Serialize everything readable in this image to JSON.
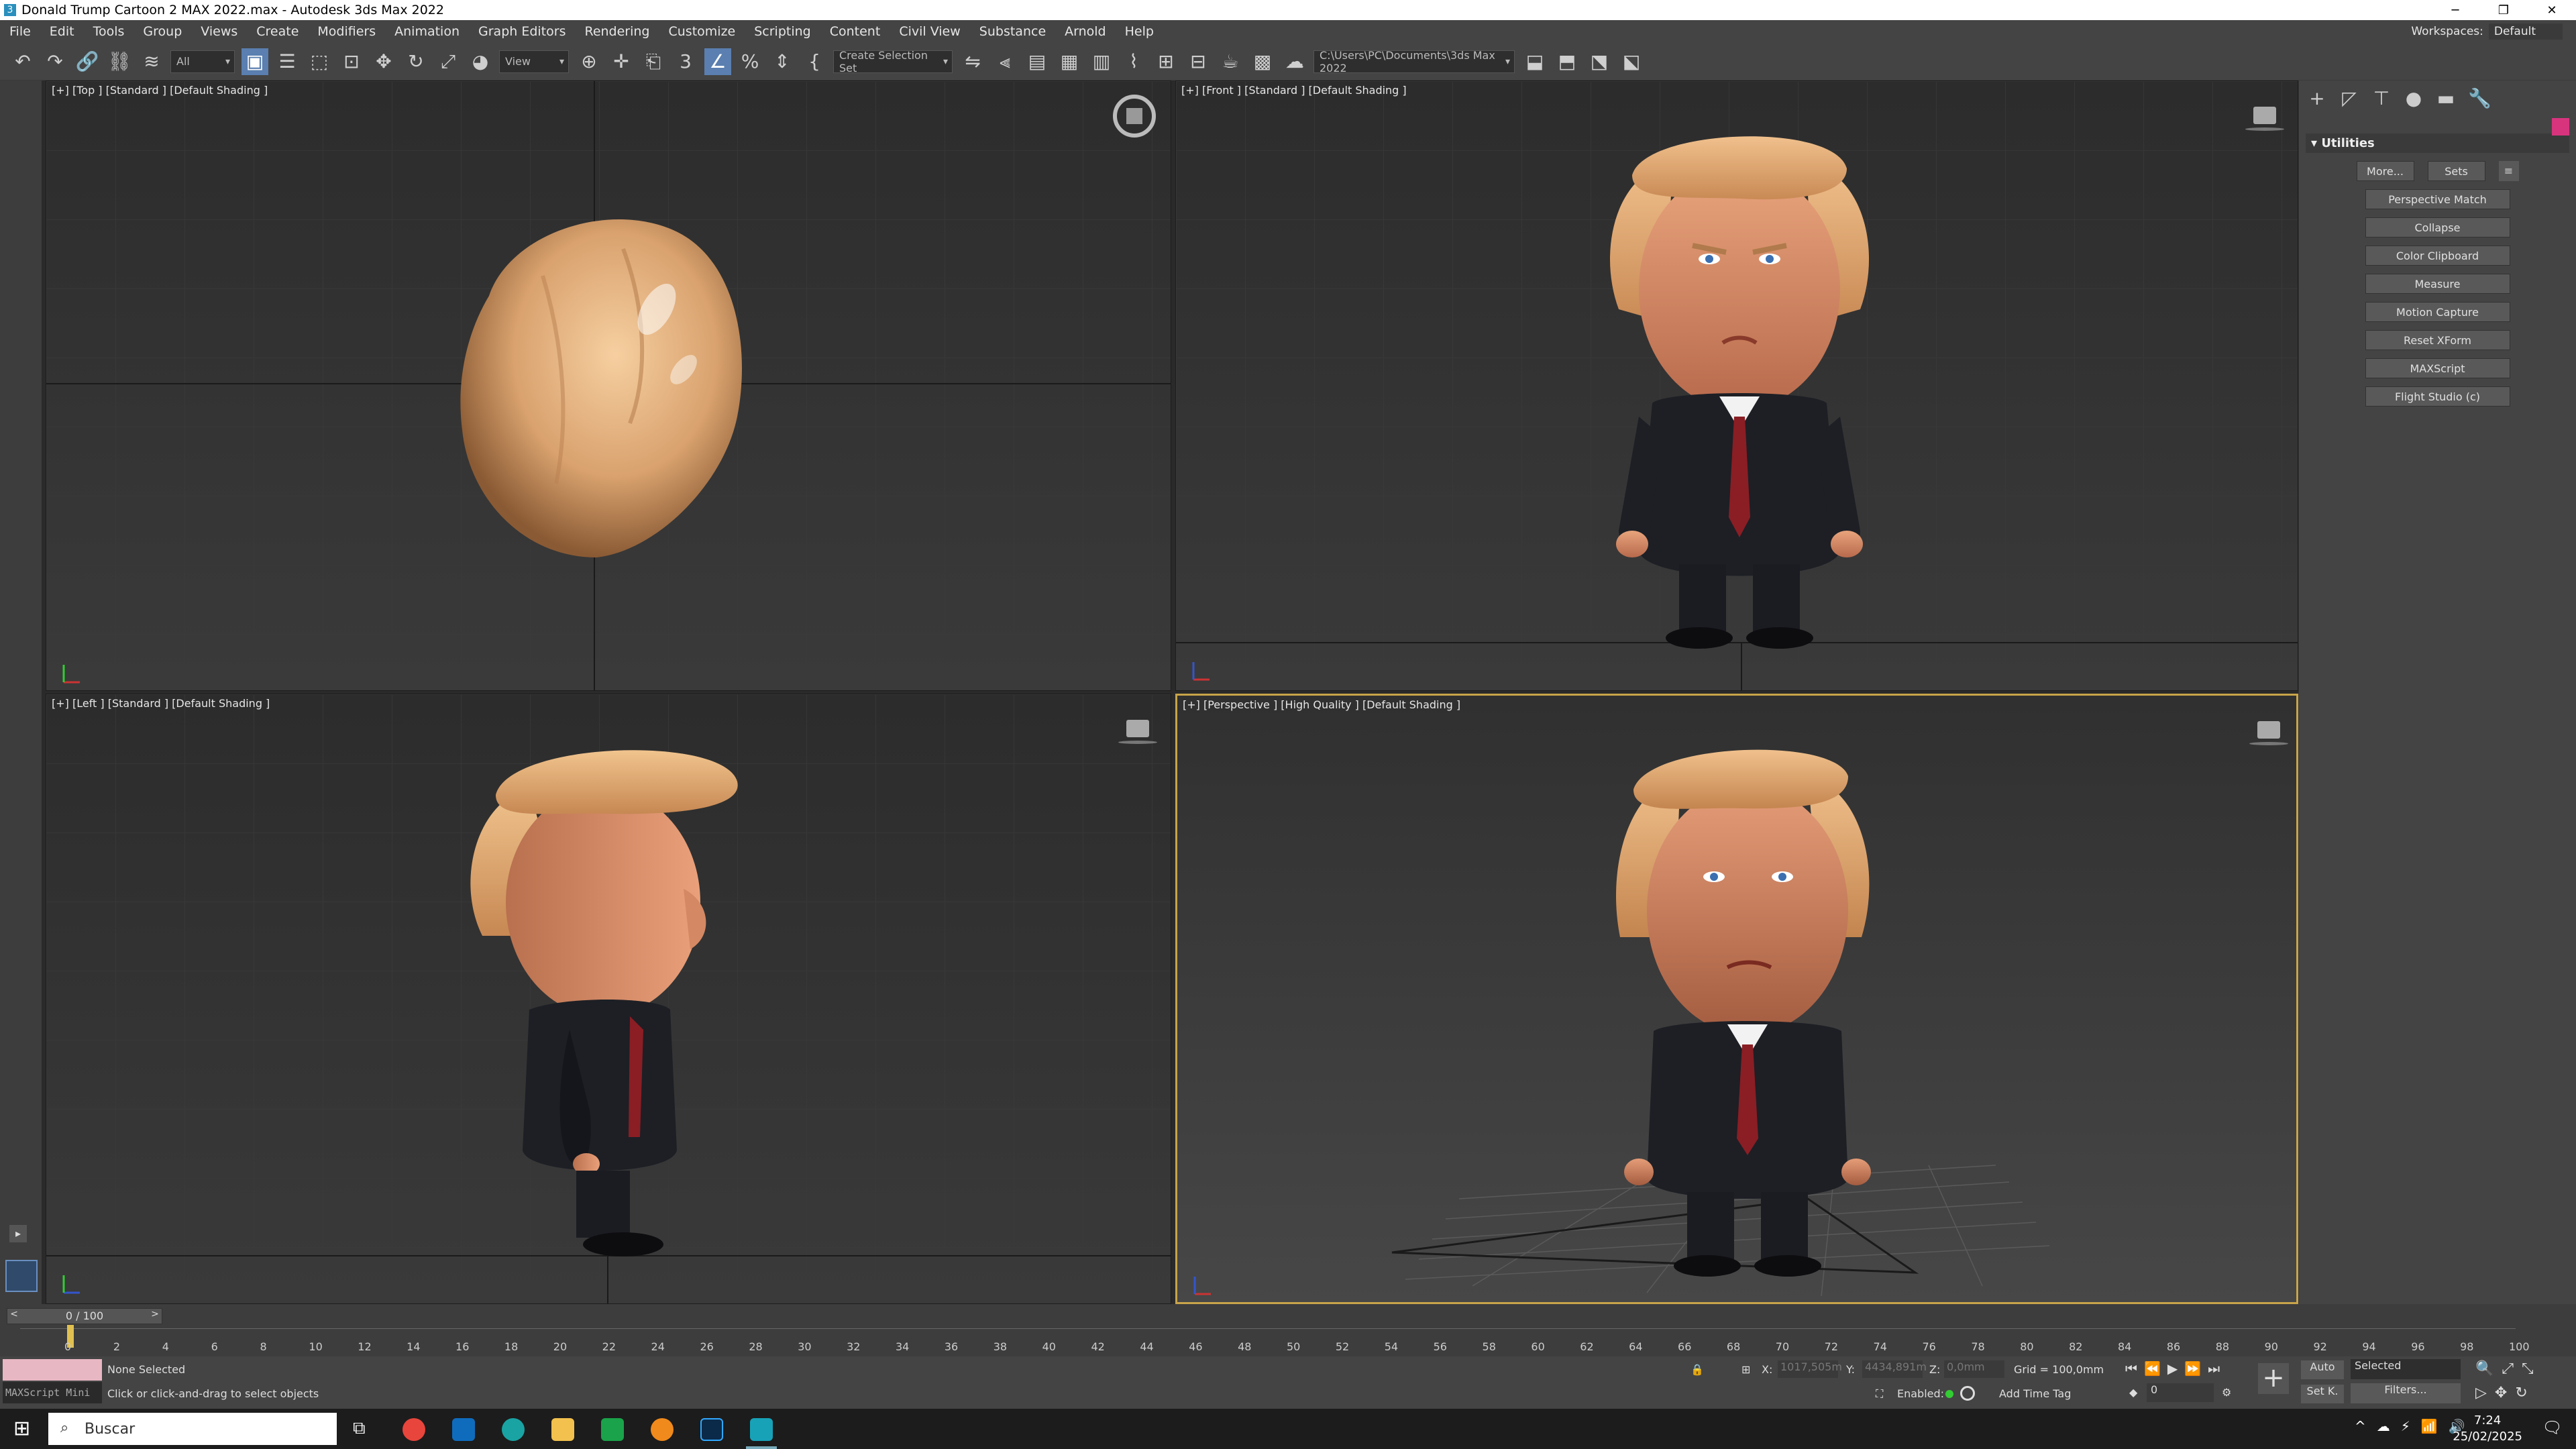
{
  "window": {
    "title": "Donald Trump Cartoon 2 MAX 2022.max - Autodesk 3ds Max 2022"
  },
  "menu": [
    "File",
    "Edit",
    "Tools",
    "Group",
    "Views",
    "Create",
    "Modifiers",
    "Animation",
    "Graph Editors",
    "Rendering",
    "Customize",
    "Scripting",
    "Content",
    "Civil View",
    "Substance",
    "Arnold",
    "Help"
  ],
  "workspace": {
    "label": "Workspaces:",
    "value": "Default"
  },
  "toolbar": {
    "filter": "All",
    "refcoord": "View",
    "selection_set": "Create Selection Set",
    "project_path": "C:\\Users\\PC\\Documents\\3ds Max 2022"
  },
  "viewports": {
    "top": "[+] [Top ] [Standard ] [Default Shading ]",
    "front": "[+] [Front ] [Standard ] [Default Shading ]",
    "left": "[+] [Left ] [Standard ] [Default Shading ]",
    "perspective": "[+] [Perspective ] [High Quality ] [Default Shading ]"
  },
  "panel": {
    "rollout": "Utilities",
    "more": "More...",
    "sets": "Sets",
    "buttons": [
      "Perspective Match",
      "Collapse",
      "Color Clipboard",
      "Measure",
      "Motion Capture",
      "Reset XForm",
      "MAXScript",
      "Flight Studio (c)"
    ]
  },
  "timeline": {
    "frame": "0 / 100",
    "ticks": [
      "0",
      "2",
      "4",
      "6",
      "8",
      "10",
      "12",
      "14",
      "16",
      "18",
      "20",
      "22",
      "24",
      "26",
      "28",
      "30",
      "32",
      "34",
      "36",
      "38",
      "40",
      "42",
      "44",
      "46",
      "48",
      "50",
      "52",
      "54",
      "56",
      "58",
      "60",
      "62",
      "64",
      "66",
      "68",
      "70",
      "72",
      "74",
      "76",
      "78",
      "80",
      "82",
      "84",
      "86",
      "88",
      "90",
      "92",
      "94",
      "96",
      "98",
      "100"
    ]
  },
  "status": {
    "maxscript": "MAXScript Mini",
    "selection": "None Selected",
    "prompt": "Click or click-and-drag to select objects",
    "x_label": "X:",
    "x": "1017,505m",
    "y_label": "Y:",
    "y": "4434,891m",
    "z_label": "Z:",
    "z": "0,0mm",
    "grid": "Grid = 100,0mm",
    "enabled": "Enabled:",
    "add_time_tag": "Add Time Tag",
    "auto": "Auto",
    "selected": "Selected",
    "set_k": "Set K.",
    "filters": "Filters...",
    "frame_field": "0"
  },
  "taskbar": {
    "search": "Buscar",
    "time": "7:24",
    "date": "25/02/2025"
  }
}
